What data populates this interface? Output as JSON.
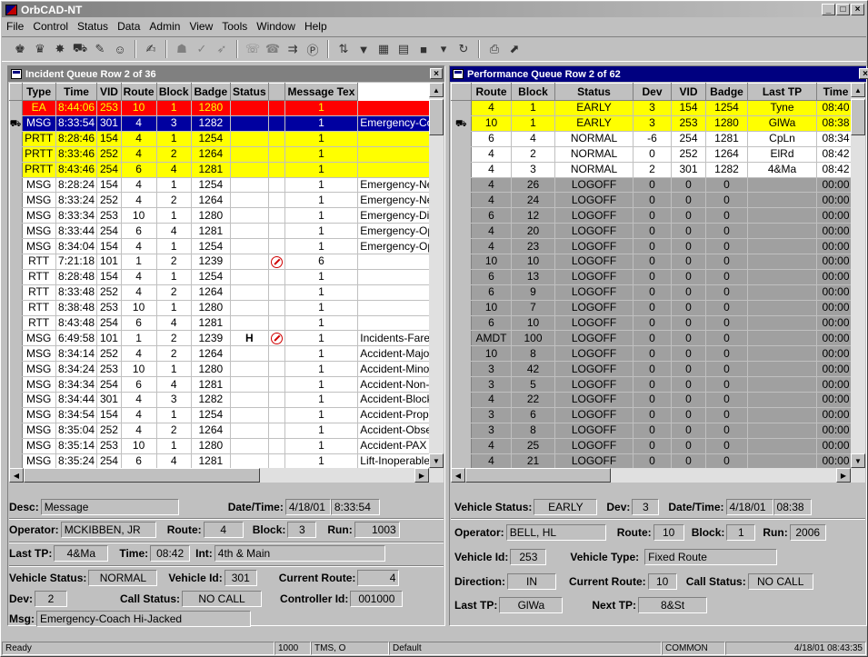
{
  "window": {
    "title": "OrbCAD-NT",
    "min": "_",
    "max": "□",
    "close": "×"
  },
  "menu": [
    "File",
    "Control",
    "Status",
    "Data",
    "Admin",
    "View",
    "Tools",
    "Window",
    "Help"
  ],
  "incident": {
    "title": "Incident Queue Row 2 of 36",
    "columns": [
      "Type",
      "Time",
      "VID",
      "Route",
      "Block",
      "Badge",
      "Status",
      "",
      "Message Tex"
    ],
    "rows": [
      {
        "type": "EA",
        "time": "8:44:06",
        "vid": "253",
        "route": "10",
        "block": "1",
        "badge": "1280",
        "s1": "",
        "s2": "",
        "s3": "1",
        "msg": "",
        "style": "red",
        "sel": ""
      },
      {
        "type": "MSG",
        "time": "8:33:54",
        "vid": "301",
        "route": "4",
        "block": "3",
        "badge": "1282",
        "s1": "",
        "s2": "",
        "s3": "1",
        "msg": "Emergency-Coa",
        "style": "blue",
        "sel": "bus"
      },
      {
        "type": "PRTT",
        "time": "8:28:46",
        "vid": "154",
        "route": "4",
        "block": "1",
        "badge": "1254",
        "s1": "",
        "s2": "",
        "s3": "1",
        "msg": "",
        "style": "yellow",
        "sel": ""
      },
      {
        "type": "PRTT",
        "time": "8:33:46",
        "vid": "252",
        "route": "4",
        "block": "2",
        "badge": "1264",
        "s1": "",
        "s2": "",
        "s3": "1",
        "msg": "",
        "style": "yellow",
        "sel": ""
      },
      {
        "type": "PRTT",
        "time": "8:43:46",
        "vid": "254",
        "route": "6",
        "block": "4",
        "badge": "1281",
        "s1": "",
        "s2": "",
        "s3": "1",
        "msg": "",
        "style": "yellow",
        "sel": ""
      },
      {
        "type": "MSG",
        "time": "8:28:24",
        "vid": "154",
        "route": "4",
        "block": "1",
        "badge": "1254",
        "s1": "",
        "s2": "",
        "s3": "1",
        "msg": "Emergency-Ne",
        "style": "white",
        "sel": ""
      },
      {
        "type": "MSG",
        "time": "8:33:24",
        "vid": "252",
        "route": "4",
        "block": "2",
        "badge": "1264",
        "s1": "",
        "s2": "",
        "s3": "1",
        "msg": "Emergency-Ne",
        "style": "white",
        "sel": ""
      },
      {
        "type": "MSG",
        "time": "8:33:34",
        "vid": "253",
        "route": "10",
        "block": "1",
        "badge": "1280",
        "s1": "",
        "s2": "",
        "s3": "1",
        "msg": "Emergency-Dis",
        "style": "white",
        "sel": ""
      },
      {
        "type": "MSG",
        "time": "8:33:44",
        "vid": "254",
        "route": "6",
        "block": "4",
        "badge": "1281",
        "s1": "",
        "s2": "",
        "s3": "1",
        "msg": "Emergency-Op",
        "style": "white",
        "sel": ""
      },
      {
        "type": "MSG",
        "time": "8:34:04",
        "vid": "154",
        "route": "4",
        "block": "1",
        "badge": "1254",
        "s1": "",
        "s2": "",
        "s3": "1",
        "msg": "Emergency-Op",
        "style": "white",
        "sel": ""
      },
      {
        "type": "RTT",
        "time": "7:21:18",
        "vid": "101",
        "route": "1",
        "block": "2",
        "badge": "1239",
        "s1": "",
        "s2": "noentry",
        "s3": "6",
        "msg": "",
        "style": "white",
        "sel": ""
      },
      {
        "type": "RTT",
        "time": "8:28:48",
        "vid": "154",
        "route": "4",
        "block": "1",
        "badge": "1254",
        "s1": "",
        "s2": "",
        "s3": "1",
        "msg": "",
        "style": "white",
        "sel": ""
      },
      {
        "type": "RTT",
        "time": "8:33:48",
        "vid": "252",
        "route": "4",
        "block": "2",
        "badge": "1264",
        "s1": "",
        "s2": "",
        "s3": "1",
        "msg": "",
        "style": "white",
        "sel": ""
      },
      {
        "type": "RTT",
        "time": "8:38:48",
        "vid": "253",
        "route": "10",
        "block": "1",
        "badge": "1280",
        "s1": "",
        "s2": "",
        "s3": "1",
        "msg": "",
        "style": "white",
        "sel": ""
      },
      {
        "type": "RTT",
        "time": "8:43:48",
        "vid": "254",
        "route": "6",
        "block": "4",
        "badge": "1281",
        "s1": "",
        "s2": "",
        "s3": "1",
        "msg": "",
        "style": "white",
        "sel": ""
      },
      {
        "type": "MSG",
        "time": "6:49:58",
        "vid": "101",
        "route": "1",
        "block": "2",
        "badge": "1239",
        "s1": "H",
        "s2": "noentry",
        "s3": "1",
        "msg": "Incidents-Fare D",
        "style": "white",
        "sel": ""
      },
      {
        "type": "MSG",
        "time": "8:34:14",
        "vid": "252",
        "route": "4",
        "block": "2",
        "badge": "1264",
        "s1": "",
        "s2": "",
        "s3": "1",
        "msg": "Accident-Major",
        "style": "white",
        "sel": ""
      },
      {
        "type": "MSG",
        "time": "8:34:24",
        "vid": "253",
        "route": "10",
        "block": "1",
        "badge": "1280",
        "s1": "",
        "s2": "",
        "s3": "1",
        "msg": "Accident-Minor",
        "style": "white",
        "sel": ""
      },
      {
        "type": "MSG",
        "time": "8:34:34",
        "vid": "254",
        "route": "6",
        "block": "4",
        "badge": "1281",
        "s1": "",
        "s2": "",
        "s3": "1",
        "msg": "Accident-Non-Ir",
        "style": "white",
        "sel": ""
      },
      {
        "type": "MSG",
        "time": "8:34:44",
        "vid": "301",
        "route": "4",
        "block": "3",
        "badge": "1282",
        "s1": "",
        "s2": "",
        "s3": "1",
        "msg": "Accident-Blocki",
        "style": "white",
        "sel": ""
      },
      {
        "type": "MSG",
        "time": "8:34:54",
        "vid": "154",
        "route": "4",
        "block": "1",
        "badge": "1254",
        "s1": "",
        "s2": "",
        "s3": "1",
        "msg": "Accident-Prope",
        "style": "white",
        "sel": ""
      },
      {
        "type": "MSG",
        "time": "8:35:04",
        "vid": "252",
        "route": "4",
        "block": "2",
        "badge": "1264",
        "s1": "",
        "s2": "",
        "s3": "1",
        "msg": "Accident-Obser",
        "style": "white",
        "sel": ""
      },
      {
        "type": "MSG",
        "time": "8:35:14",
        "vid": "253",
        "route": "10",
        "block": "1",
        "badge": "1280",
        "s1": "",
        "s2": "",
        "s3": "1",
        "msg": "Accident-PAX F",
        "style": "white",
        "sel": ""
      },
      {
        "type": "MSG",
        "time": "8:35:24",
        "vid": "254",
        "route": "6",
        "block": "4",
        "badge": "1281",
        "s1": "",
        "s2": "",
        "s3": "1",
        "msg": "Lift-Inoperable v",
        "style": "white",
        "sel": ""
      }
    ],
    "detail": {
      "desc_label": "Desc:",
      "desc": "Message",
      "datetime_label": "Date/Time:",
      "date": "4/18/01",
      "time": "8:33:54",
      "operator_label": "Operator:",
      "operator": "MCKIBBEN, JR",
      "route_label": "Route:",
      "route": "4",
      "block_label": "Block:",
      "block": "3",
      "run_label": "Run:",
      "run": "1003",
      "lasttp_label": "Last TP:",
      "lasttp": "4&Ma",
      "time_label": "Time:",
      "tptime": "08:42",
      "int_label": "Int:",
      "int": "4th & Main",
      "vstatus_label": "Vehicle Status:",
      "vstatus": "NORMAL",
      "vid_label": "Vehicle Id:",
      "vid": "301",
      "croute_label": "Current Route:",
      "croute": "4",
      "dev_label": "Dev:",
      "dev": "2",
      "callstatus_label": "Call Status:",
      "callstatus": "NO CALL",
      "ctrl_label": "Controller Id:",
      "ctrl": "001000",
      "msg_label": "Msg:",
      "msg": "Emergency-Coach Hi-Jacked"
    }
  },
  "performance": {
    "title": "Performance Queue Row 2 of 62",
    "columns": [
      "Route",
      "Block",
      "Status",
      "Dev",
      "VID",
      "Badge",
      "Last TP",
      "Time"
    ],
    "rows": [
      {
        "route": "4",
        "block": "1",
        "status": "EARLY",
        "dev": "3",
        "vid": "154",
        "badge": "1254",
        "tp": "Tyne",
        "time": "08:40",
        "style": "yellow",
        "sel": ""
      },
      {
        "route": "10",
        "block": "1",
        "status": "EARLY",
        "dev": "3",
        "vid": "253",
        "badge": "1280",
        "tp": "GlWa",
        "time": "08:38",
        "style": "yellow",
        "sel": "bus"
      },
      {
        "route": "6",
        "block": "4",
        "status": "NORMAL",
        "dev": "-6",
        "vid": "254",
        "badge": "1281",
        "tp": "CpLn",
        "time": "08:34",
        "style": "white",
        "sel": ""
      },
      {
        "route": "4",
        "block": "2",
        "status": "NORMAL",
        "dev": "0",
        "vid": "252",
        "badge": "1264",
        "tp": "ElRd",
        "time": "08:42",
        "style": "white",
        "sel": ""
      },
      {
        "route": "4",
        "block": "3",
        "status": "NORMAL",
        "dev": "2",
        "vid": "301",
        "badge": "1282",
        "tp": "4&Ma",
        "time": "08:42",
        "style": "white",
        "sel": ""
      },
      {
        "route": "4",
        "block": "26",
        "status": "LOGOFF",
        "dev": "0",
        "vid": "0",
        "badge": "0",
        "tp": "",
        "time": "00:00",
        "style": "gray",
        "sel": ""
      },
      {
        "route": "4",
        "block": "24",
        "status": "LOGOFF",
        "dev": "0",
        "vid": "0",
        "badge": "0",
        "tp": "",
        "time": "00:00",
        "style": "gray",
        "sel": ""
      },
      {
        "route": "6",
        "block": "12",
        "status": "LOGOFF",
        "dev": "0",
        "vid": "0",
        "badge": "0",
        "tp": "",
        "time": "00:00",
        "style": "gray",
        "sel": ""
      },
      {
        "route": "4",
        "block": "20",
        "status": "LOGOFF",
        "dev": "0",
        "vid": "0",
        "badge": "0",
        "tp": "",
        "time": "00:00",
        "style": "gray",
        "sel": ""
      },
      {
        "route": "4",
        "block": "23",
        "status": "LOGOFF",
        "dev": "0",
        "vid": "0",
        "badge": "0",
        "tp": "",
        "time": "00:00",
        "style": "gray",
        "sel": ""
      },
      {
        "route": "10",
        "block": "10",
        "status": "LOGOFF",
        "dev": "0",
        "vid": "0",
        "badge": "0",
        "tp": "",
        "time": "00:00",
        "style": "gray",
        "sel": ""
      },
      {
        "route": "6",
        "block": "13",
        "status": "LOGOFF",
        "dev": "0",
        "vid": "0",
        "badge": "0",
        "tp": "",
        "time": "00:00",
        "style": "gray",
        "sel": ""
      },
      {
        "route": "6",
        "block": "9",
        "status": "LOGOFF",
        "dev": "0",
        "vid": "0",
        "badge": "0",
        "tp": "",
        "time": "00:00",
        "style": "gray",
        "sel": ""
      },
      {
        "route": "10",
        "block": "7",
        "status": "LOGOFF",
        "dev": "0",
        "vid": "0",
        "badge": "0",
        "tp": "",
        "time": "00:00",
        "style": "gray",
        "sel": ""
      },
      {
        "route": "6",
        "block": "10",
        "status": "LOGOFF",
        "dev": "0",
        "vid": "0",
        "badge": "0",
        "tp": "",
        "time": "00:00",
        "style": "gray",
        "sel": ""
      },
      {
        "route": "AMDT",
        "block": "100",
        "status": "LOGOFF",
        "dev": "0",
        "vid": "0",
        "badge": "0",
        "tp": "",
        "time": "00:00",
        "style": "gray",
        "sel": ""
      },
      {
        "route": "10",
        "block": "8",
        "status": "LOGOFF",
        "dev": "0",
        "vid": "0",
        "badge": "0",
        "tp": "",
        "time": "00:00",
        "style": "gray",
        "sel": ""
      },
      {
        "route": "3",
        "block": "42",
        "status": "LOGOFF",
        "dev": "0",
        "vid": "0",
        "badge": "0",
        "tp": "",
        "time": "00:00",
        "style": "gray",
        "sel": ""
      },
      {
        "route": "3",
        "block": "5",
        "status": "LOGOFF",
        "dev": "0",
        "vid": "0",
        "badge": "0",
        "tp": "",
        "time": "00:00",
        "style": "gray",
        "sel": ""
      },
      {
        "route": "4",
        "block": "22",
        "status": "LOGOFF",
        "dev": "0",
        "vid": "0",
        "badge": "0",
        "tp": "",
        "time": "00:00",
        "style": "gray",
        "sel": ""
      },
      {
        "route": "3",
        "block": "6",
        "status": "LOGOFF",
        "dev": "0",
        "vid": "0",
        "badge": "0",
        "tp": "",
        "time": "00:00",
        "style": "gray",
        "sel": ""
      },
      {
        "route": "3",
        "block": "8",
        "status": "LOGOFF",
        "dev": "0",
        "vid": "0",
        "badge": "0",
        "tp": "",
        "time": "00:00",
        "style": "gray",
        "sel": ""
      },
      {
        "route": "4",
        "block": "25",
        "status": "LOGOFF",
        "dev": "0",
        "vid": "0",
        "badge": "0",
        "tp": "",
        "time": "00:00",
        "style": "gray",
        "sel": ""
      },
      {
        "route": "4",
        "block": "21",
        "status": "LOGOFF",
        "dev": "0",
        "vid": "0",
        "badge": "0",
        "tp": "",
        "time": "00:00",
        "style": "gray",
        "sel": ""
      }
    ],
    "detail": {
      "vstatus_label": "Vehicle Status:",
      "vstatus": "EARLY",
      "dev_label": "Dev:",
      "dev": "3",
      "datetime_label": "Date/Time:",
      "date": "4/18/01",
      "time": "08:38",
      "operator_label": "Operator:",
      "operator": "BELL, HL",
      "route_label": "Route:",
      "route": "10",
      "block_label": "Block:",
      "block": "1",
      "run_label": "Run:",
      "run": "2006",
      "vid_label": "Vehicle Id:",
      "vid": "253",
      "vtype_label": "Vehicle Type:",
      "vtype": "Fixed Route",
      "dir_label": "Direction:",
      "dir": "IN",
      "croute_label": "Current Route:",
      "croute": "10",
      "callstatus_label": "Call Status:",
      "callstatus": "NO CALL",
      "lasttp_label": "Last TP:",
      "lasttp": "GlWa",
      "nexttp_label": "Next TP:",
      "nexttp": "8&St"
    }
  },
  "statusbar": {
    "ready": "Ready",
    "code": "1000",
    "tms": "TMS, O",
    "default": "Default",
    "common": "COMMON",
    "datetime": "4/18/01 08:43:35"
  },
  "colors": {
    "alert_red": "#ff0000",
    "selected_blue": "#0000a0",
    "warning_yellow": "#ffff00",
    "logoff_gray": "#a0a0a0",
    "active_title": "#000080"
  }
}
